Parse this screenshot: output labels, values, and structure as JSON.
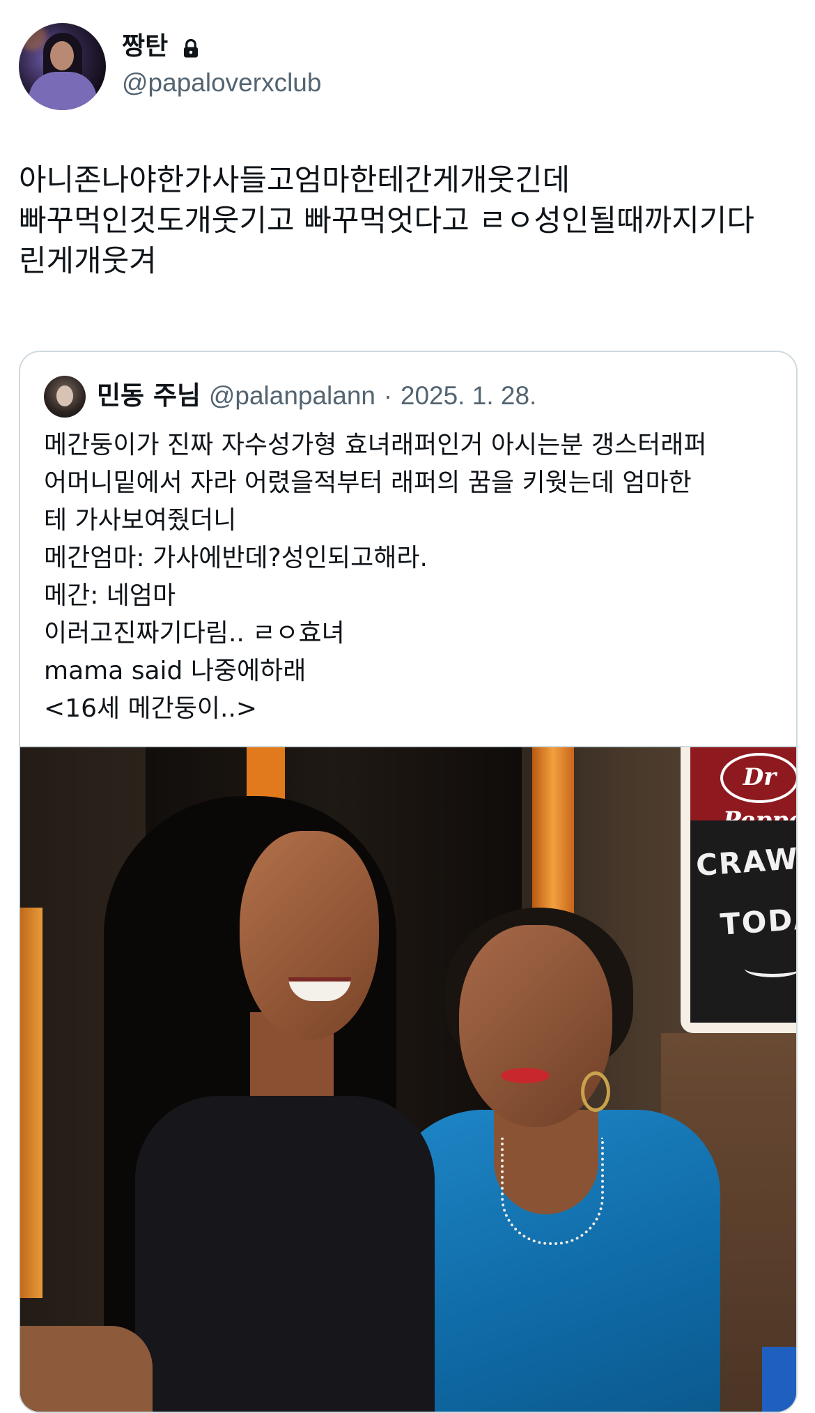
{
  "tweet": {
    "author": {
      "display_name": "짱탄",
      "handle": "@papaloverxclub"
    },
    "text_lines": [
      "아니존나야한가사들고엄마한테간게개웃긴데",
      "빠꾸먹인것도개웃기고 빠꾸먹엇다고 ㄹㅇ성인될때까지기다",
      "린게개웃겨"
    ]
  },
  "quoted_tweet": {
    "author": {
      "display_name": "민동 주님",
      "handle": "@palanpalann",
      "separator": "·",
      "date": "2025. 1. 28."
    },
    "text_lines": [
      "메간둥이가 진짜 자수성가형 효녀래퍼인거 아시는분 갱스터래퍼",
      "어머니밑에서 자라 어렸을적부터 래퍼의 꿈을 키웟는데 엄마한",
      "테 가사보여줬더니",
      "메간엄마: 가사에반데?성인되고해라.",
      "메간: 네엄마",
      "이러고진짜기다림.. ㄹㅇ효녀",
      "mama said 나중에하래",
      "<16세 메간둥이..>"
    ],
    "photo": {
      "sign_logo": "Dr Pepper",
      "sign_line1": "CRAW",
      "sign_line2": "TODA"
    }
  },
  "colors": {
    "text": "#0f1419",
    "secondary": "#536471",
    "border": "#cfd9de"
  }
}
